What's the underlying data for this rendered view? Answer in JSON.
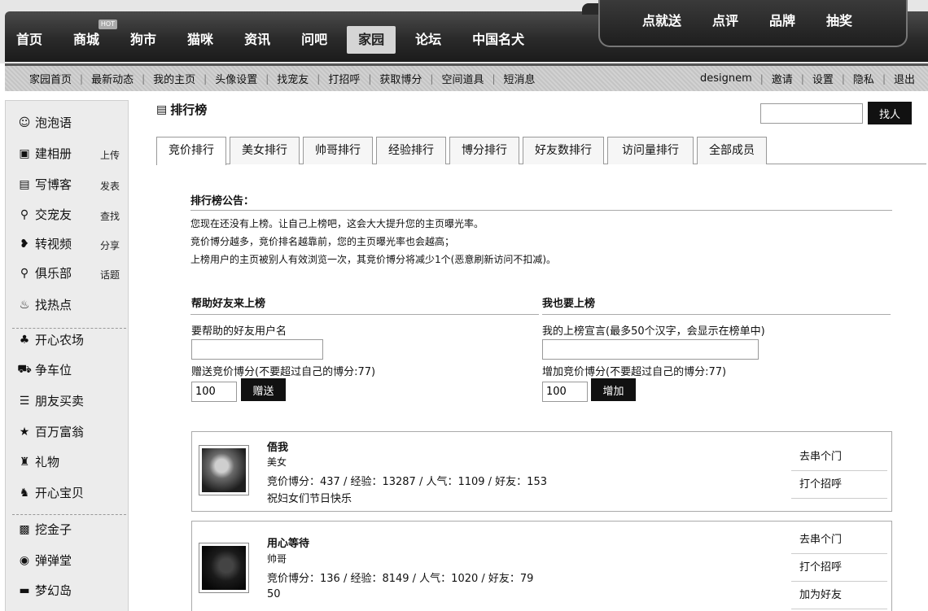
{
  "nav": {
    "items": [
      "首页",
      "商城",
      "狗市",
      "猫咪",
      "资讯",
      "问吧",
      "家园",
      "论坛",
      "中国名犬"
    ],
    "hot_badge": "HOT",
    "promo": [
      "点就送",
      "点评",
      "品牌",
      "抽奖"
    ]
  },
  "subnav": {
    "left": [
      "家园首页",
      "最新动态",
      "我的主页",
      "头像设置",
      "找宠友",
      "打招呼",
      "获取博分",
      "空间道具",
      "短消息"
    ],
    "username": "designem",
    "right": [
      "邀请",
      "设置",
      "隐私",
      "退出"
    ]
  },
  "sidebar": {
    "items": [
      {
        "icon": "☺",
        "label": "泡泡语",
        "action": ""
      },
      {
        "icon": "▣",
        "label": "建相册",
        "action": "上传"
      },
      {
        "icon": "▤",
        "label": "写博客",
        "action": "发表"
      },
      {
        "icon": "⚲",
        "label": "交宠友",
        "action": "查找"
      },
      {
        "icon": "❥",
        "label": "转视频",
        "action": "分享"
      },
      {
        "icon": "⚲",
        "label": "俱乐部",
        "action": "话题"
      },
      {
        "icon": "♨",
        "label": "找热点",
        "action": ""
      },
      {
        "icon": "♣",
        "label": "开心农场",
        "action": ""
      },
      {
        "icon": "⛟",
        "label": "争车位",
        "action": ""
      },
      {
        "icon": "☰",
        "label": "朋友买卖",
        "action": ""
      },
      {
        "icon": "★",
        "label": "百万富翁",
        "action": ""
      },
      {
        "icon": "♜",
        "label": "礼物",
        "action": ""
      },
      {
        "icon": "♞",
        "label": "开心宝贝",
        "action": ""
      },
      {
        "icon": "▩",
        "label": "挖金子",
        "action": ""
      },
      {
        "icon": "◉",
        "label": "弹弹堂",
        "action": ""
      },
      {
        "icon": "▬",
        "label": "梦幻岛",
        "action": ""
      }
    ]
  },
  "main": {
    "title": "排行榜",
    "search_button": "找人",
    "tabs": [
      "竞价排行",
      "美女排行",
      "帅哥排行",
      "经验排行",
      "博分排行",
      "好友数排行",
      "访问量排行",
      "全部成员"
    ],
    "notice": {
      "title": "排行榜公告：",
      "lines": [
        "您现在还没有上榜。让自己上榜吧，这会大大提升您的主页曝光率。",
        "竞价博分越多，竞价排名越靠前，您的主页曝光率也会越高；",
        "上榜用户的主页被别人有效浏览一次，其竞价博分将减少1个(恶意刷新访问不扣减)。"
      ]
    },
    "help_friend": {
      "title": "帮助好友来上榜",
      "username_label": "要帮助的好友用户名",
      "points_label": "赠送竞价博分(不要超过自己的博分:77)",
      "points_value": "100",
      "button": "赠送"
    },
    "self_rank": {
      "title": "我也要上榜",
      "motto_label": "我的上榜宣言(最多50个汉字，会显示在榜单中)",
      "points_label": "增加竞价博分(不要超过自己的博分:77)",
      "points_value": "100",
      "button": "增加"
    },
    "ranks": [
      {
        "name": "俉我",
        "tag": "美女",
        "stats": "竞价博分：437 / 经验：13287 / 人气：1109 / 好友：153",
        "motto": "祝妇女们节日快乐",
        "actions": [
          "去串个门",
          "打个招呼"
        ]
      },
      {
        "name": "用心等待",
        "tag": "帅哥",
        "stats": "竞价博分：136 / 经验：8149 / 人气：1020 / 好友：79",
        "motto": "50",
        "actions": [
          "去串个门",
          "打个招呼",
          "加为好友"
        ]
      }
    ]
  }
}
